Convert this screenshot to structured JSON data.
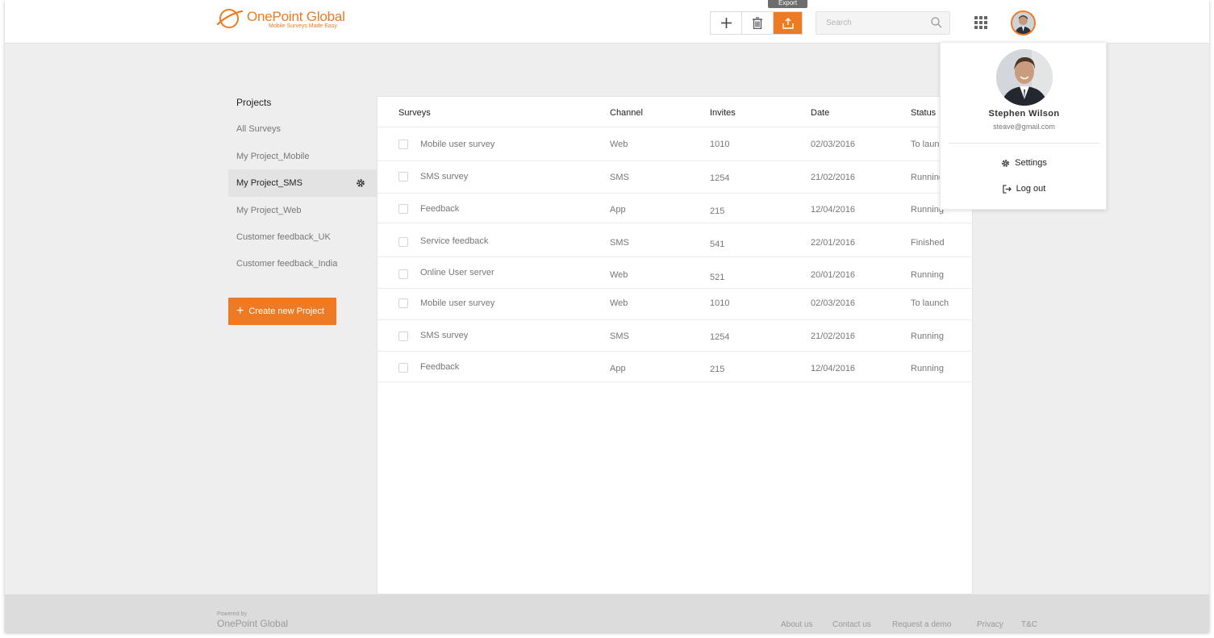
{
  "header": {
    "logo_title": "OnePoint Global",
    "logo_tagline": "Mobile Surveys Made Easy",
    "tooltip": "Export",
    "search_placeholder": "Search"
  },
  "sidebar": {
    "title": "Projects",
    "items": [
      {
        "label": "All Surveys"
      },
      {
        "label": "My Project_Mobile"
      },
      {
        "label": "My Project_SMS"
      },
      {
        "label": "My Project_Web"
      },
      {
        "label": "Customer feedback_UK"
      },
      {
        "label": "Customer feedback_India"
      }
    ],
    "active_index": 2,
    "create_label": "Create new Project"
  },
  "table": {
    "columns": [
      "Surveys",
      "Channel",
      "Invites",
      "Date",
      "Status"
    ],
    "rows": [
      {
        "survey": "Mobile user survey",
        "channel": "Web",
        "invites": "1010",
        "date": "02/03/2016",
        "status": "To launch"
      },
      {
        "survey": "SMS survey",
        "channel": "SMS",
        "invites": "1254",
        "date": "21/02/2016",
        "status": "Running"
      },
      {
        "survey": "Feedback",
        "channel": "App",
        "invites": "215",
        "date": "12/04/2016",
        "status": "Running"
      },
      {
        "survey": "Service feedback",
        "channel": "SMS",
        "invites": "541",
        "date": "22/01/2016",
        "status": "Finished"
      },
      {
        "survey": "Online User server",
        "channel": "Web",
        "invites": "521",
        "date": "20/01/2016",
        "status": "Running"
      },
      {
        "survey": "Mobile user survey",
        "channel": "Web",
        "invites": "1010",
        "date": "02/03/2016",
        "status": "To launch"
      },
      {
        "survey": "SMS survey",
        "channel": "SMS",
        "invites": "1254",
        "date": "21/02/2016",
        "status": "Running"
      },
      {
        "survey": "Feedback",
        "channel": "App",
        "invites": "215",
        "date": "12/04/2016",
        "status": "Running"
      }
    ]
  },
  "profile_menu": {
    "name": "Stephen Wilson",
    "email": "steave@gmail.com",
    "settings_label": "Settings",
    "logout_label": "Log out"
  },
  "footer": {
    "powered_by": "Powered by",
    "brand": "OnePoint Global",
    "links": [
      "About us",
      "Contact us",
      "Request a demo",
      "Privacy",
      "T&C"
    ]
  },
  "colors": {
    "accent": "#ee7a23",
    "background": "#eeeeee",
    "footer": "#dcdcdc"
  }
}
